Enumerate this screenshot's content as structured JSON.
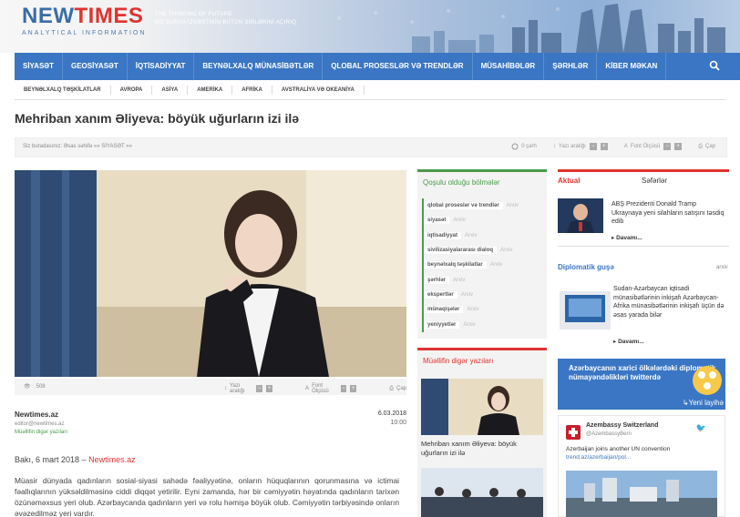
{
  "header": {
    "logo_new": "NEW",
    "logo_times": "TIMES",
    "logo_sub": "ANALYTICAL INFORMATION",
    "tagline_line1": "THE THINKING OF FUTURE",
    "tagline_line2": "BİZ DÜNYA İZVƏSTİNİN BÜTÜN SİRLƏRİNİ AÇIRIQ"
  },
  "nav": {
    "items": [
      "SİYASƏT",
      "GEOSİYASƏT",
      "İQTİSADİYYAT",
      "BEYNƏLXALQ MÜNASİBƏTLƏR",
      "QLOBAL PROSESLƏR VƏ TRENDLƏR",
      "MÜSAHİBƏLƏR",
      "ŞƏRHLƏR",
      "KİBER MƏKAN"
    ],
    "search_icon": "search-icon"
  },
  "subnav": {
    "items": [
      "BEYNƏLXALQ TƏŞKİLATLAR",
      "AVROPA",
      "ASİYA",
      "AMERİKA",
      "AFRİKA",
      "AVSTRALİYA VƏ OKEANİYA"
    ]
  },
  "article": {
    "title": "Mehriban xanım Əliyeva: böyük uğurların izi ilə",
    "breadcrumb_prefix": "Siz buradasınız:",
    "breadcrumb_home": "Əsas səhifə",
    "breadcrumb_sep": "»»",
    "breadcrumb_section": "SİYASƏT",
    "breadcrumb_end": "»»",
    "print_count": "0 çərh",
    "spacing_label": "Yazı aralığı",
    "font_label": "Font Ölçüsü",
    "print_label": "Çap",
    "views": "508",
    "source": "Newtimes.az",
    "email": "editor@newtimes.az",
    "author_other": "Müəllifin digər yazıları",
    "date": "6.03.2018",
    "time": "10:00",
    "lead_place": "Bakı, 6 mart 2018 –",
    "lead_link": "Newtimes.az",
    "body": "Müasir dünyada qadınların sosial-siyasi sahədə fəaliyyətinə, onların hüquqlarının qorunmasına və ictimai fəallıqlarının yüksəldilməsinə ciddi diqqət yetirilir. Eyni zamanda, hər bir cəmiyyətin həyatında qadınların tarixən özünəməxsus yeri olub. Azərbaycanda qadınların yeri və rolu həmişə böyük olub. Cəmiyyətin tərbiyəsində onların əvəzedilməz yeri vardır."
  },
  "tags_panel": {
    "title": "Qoşulu olduğu bölmələr",
    "archive": "Arxiv",
    "tags": [
      "qlobal proseslər və trendlər",
      "siyasət",
      "iqtisadiyyat",
      "sivilizasiyalararası dialoq",
      "beynəlxalq təşkilatlar",
      "şərhlər",
      "ekspertlər",
      "münaqişələr",
      "yeniyyetlər"
    ]
  },
  "other_panel": {
    "title": "Müəllifin digər yazıları",
    "item1": "Mehriban xanım Əliyeva: böyük uğurların izi ilə"
  },
  "right": {
    "tab_active": "Aktual",
    "tab_other": "Səfərlər",
    "news1": "ABŞ Prezidenti Donald Tramp Ukraynaya yeni silahların satışını təsdiq edib",
    "more": "Davamı...",
    "dip_title": "Diplomatik guşə",
    "dip_archive": "arxiv",
    "news2": "Sudan-Azərbaycan iqtisadi münasibətlərinin inkişafı Azərbaycan-Afrika münasibətlərinin inkişafı üçün də əsas yarada bilər",
    "banner_text": "Azərbaycanın xarici ölkələrdəki diplomatik nümayəndəlikləri twitterdə",
    "banner_link": "Yeni layihə",
    "tweet_name": "Azembassy Switzerland",
    "tweet_handle": "@AzembassyBern",
    "tweet_text": "Azerbaijan joins another UN convention",
    "tweet_link": "trend.az/azerbaijan/pol..."
  },
  "colors": {
    "nav_blue": "#3a76c3",
    "accent_red": "#e0332f",
    "tag_green": "#4a9a4a"
  }
}
